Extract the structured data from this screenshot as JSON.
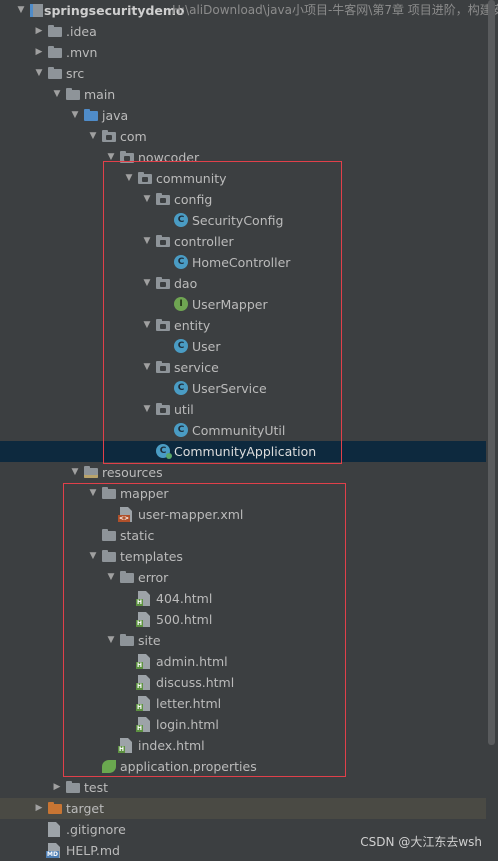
{
  "project": {
    "name": "springsecuritydemo",
    "path": "H:\\aliDownload\\java小项目-牛客网\\第7章 项目进阶，构建安"
  },
  "tree": [
    {
      "label": "springsecuritydemo",
      "depth": 0,
      "icon": "module",
      "arrow": "down",
      "kind": "project"
    },
    {
      "label": ".idea",
      "depth": 1,
      "icon": "folder",
      "arrow": "right"
    },
    {
      "label": ".mvn",
      "depth": 1,
      "icon": "folder",
      "arrow": "right"
    },
    {
      "label": "src",
      "depth": 1,
      "icon": "folder",
      "arrow": "down"
    },
    {
      "label": "main",
      "depth": 2,
      "icon": "folder",
      "arrow": "down"
    },
    {
      "label": "java",
      "depth": 3,
      "icon": "folder-blue",
      "arrow": "down"
    },
    {
      "label": "com",
      "depth": 4,
      "icon": "package",
      "arrow": "down"
    },
    {
      "label": "nowcoder",
      "depth": 5,
      "icon": "package",
      "arrow": "down"
    },
    {
      "label": "community",
      "depth": 6,
      "icon": "package",
      "arrow": "down"
    },
    {
      "label": "config",
      "depth": 7,
      "icon": "package",
      "arrow": "down"
    },
    {
      "label": "SecurityConfig",
      "depth": 8,
      "icon": "class",
      "arrow": ""
    },
    {
      "label": "controller",
      "depth": 7,
      "icon": "package",
      "arrow": "down"
    },
    {
      "label": "HomeController",
      "depth": 8,
      "icon": "class",
      "arrow": ""
    },
    {
      "label": "dao",
      "depth": 7,
      "icon": "package",
      "arrow": "down"
    },
    {
      "label": "UserMapper",
      "depth": 8,
      "icon": "interface",
      "arrow": ""
    },
    {
      "label": "entity",
      "depth": 7,
      "icon": "package",
      "arrow": "down"
    },
    {
      "label": "User",
      "depth": 8,
      "icon": "class",
      "arrow": ""
    },
    {
      "label": "service",
      "depth": 7,
      "icon": "package",
      "arrow": "down"
    },
    {
      "label": "UserService",
      "depth": 8,
      "icon": "class",
      "arrow": ""
    },
    {
      "label": "util",
      "depth": 7,
      "icon": "package",
      "arrow": "down"
    },
    {
      "label": "CommunityUtil",
      "depth": 8,
      "icon": "class",
      "arrow": ""
    },
    {
      "label": "CommunityApplication",
      "depth": 7,
      "icon": "app",
      "arrow": "",
      "selected": true
    },
    {
      "label": "resources",
      "depth": 3,
      "icon": "folder-res",
      "arrow": "down"
    },
    {
      "label": "mapper",
      "depth": 4,
      "icon": "folder",
      "arrow": "down"
    },
    {
      "label": "user-mapper.xml",
      "depth": 5,
      "icon": "xml",
      "arrow": ""
    },
    {
      "label": "static",
      "depth": 4,
      "icon": "folder",
      "arrow": ""
    },
    {
      "label": "templates",
      "depth": 4,
      "icon": "folder",
      "arrow": "down"
    },
    {
      "label": "error",
      "depth": 5,
      "icon": "folder",
      "arrow": "down"
    },
    {
      "label": "404.html",
      "depth": 6,
      "icon": "html",
      "arrow": ""
    },
    {
      "label": "500.html",
      "depth": 6,
      "icon": "html",
      "arrow": ""
    },
    {
      "label": "site",
      "depth": 5,
      "icon": "folder",
      "arrow": "down"
    },
    {
      "label": "admin.html",
      "depth": 6,
      "icon": "html",
      "arrow": ""
    },
    {
      "label": "discuss.html",
      "depth": 6,
      "icon": "html",
      "arrow": ""
    },
    {
      "label": "letter.html",
      "depth": 6,
      "icon": "html",
      "arrow": ""
    },
    {
      "label": "login.html",
      "depth": 6,
      "icon": "html",
      "arrow": ""
    },
    {
      "label": "index.html",
      "depth": 5,
      "icon": "html",
      "arrow": ""
    },
    {
      "label": "application.properties",
      "depth": 4,
      "icon": "properties",
      "arrow": ""
    },
    {
      "label": "test",
      "depth": 2,
      "icon": "folder",
      "arrow": "right"
    },
    {
      "label": "target",
      "depth": 1,
      "icon": "folder-orange",
      "arrow": "right",
      "target": true
    },
    {
      "label": ".gitignore",
      "depth": 1,
      "icon": "text",
      "arrow": ""
    },
    {
      "label": "HELP.md",
      "depth": 1,
      "icon": "md",
      "arrow": ""
    }
  ],
  "badges": {
    "class": "C",
    "interface": "I",
    "html": "H",
    "xml": "<>",
    "md": "MD"
  },
  "colors": {
    "highlight_box": "#e0404a",
    "selected_row": "#0d293e",
    "background": "#3c3f41"
  },
  "watermark": "CSDN @大江东去wsh"
}
